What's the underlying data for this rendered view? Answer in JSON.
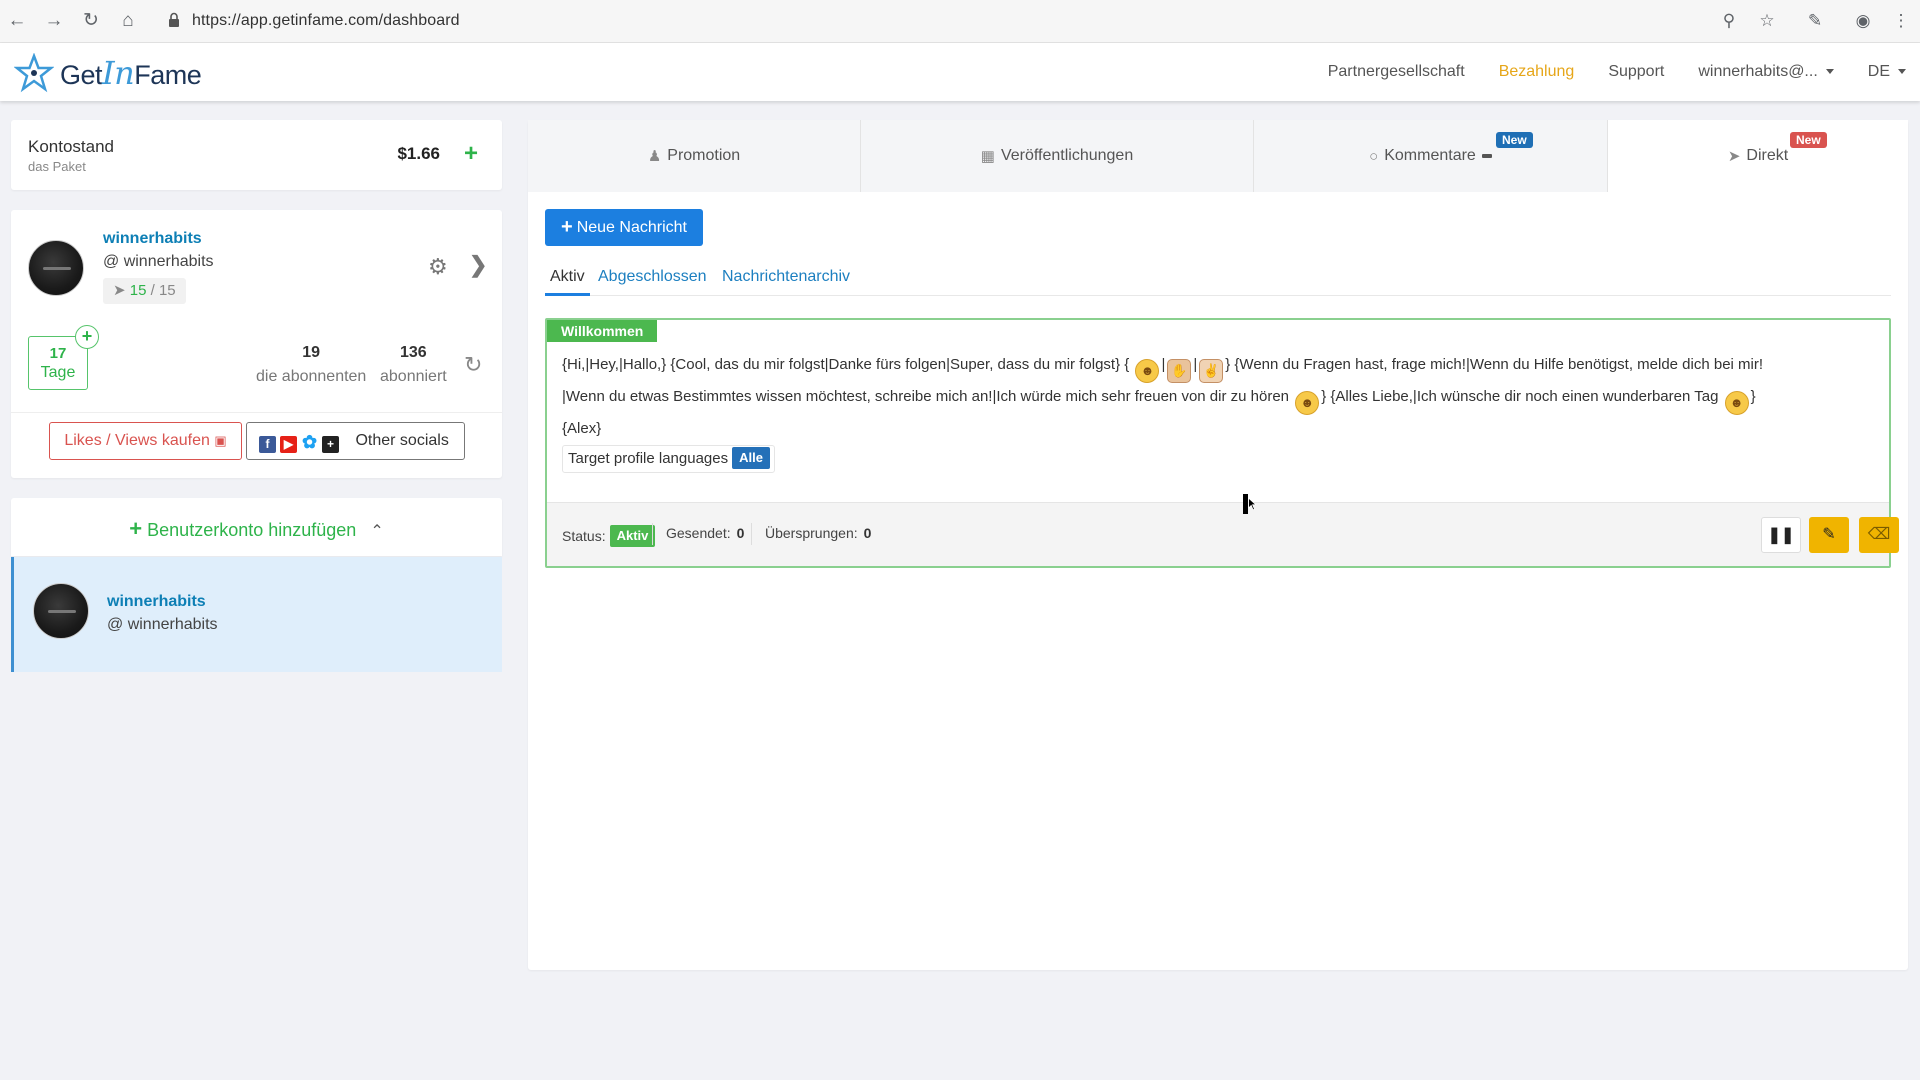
{
  "browser": {
    "url": "https://app.getinfame.com/dashboard",
    "icons": [
      "back-icon",
      "forward-icon",
      "reload-icon",
      "home-icon",
      "lock-icon",
      "key-icon",
      "star-icon",
      "extension-icon",
      "profile-icon",
      "menu-icon"
    ]
  },
  "header": {
    "logo_text_1": "Get",
    "logo_text_2": "In",
    "logo_text_3": "Fame",
    "nav": [
      {
        "label": "Partnergesellschaft"
      },
      {
        "label": "Bezahlung",
        "active": true
      },
      {
        "label": "Support"
      },
      {
        "label": "winnerhabits@..."
      },
      {
        "label": "DE"
      }
    ]
  },
  "balance": {
    "title": "Kontostand",
    "subtitle": "das Paket",
    "amount": "$1.66"
  },
  "profile": {
    "username": "winnerhabits",
    "handle": "@ winnerhabits",
    "quota_used": "15",
    "quota_sep": " / ",
    "quota_total": "15",
    "days_value": "17",
    "days_label": "Tage",
    "subscribers_value": "19",
    "subscribers_label": "die abonnenten",
    "subscribed_value": "136",
    "subscribed_label": "abonniert",
    "likes_button": "Likes / Views kaufen",
    "socials_button": "Other socials"
  },
  "accounts": {
    "add_label": "Benutzerkonto hinzufügen",
    "items": [
      {
        "username": "winnerhabits",
        "handle": "@ winnerhabits"
      }
    ]
  },
  "tabs": [
    {
      "label": "Promotion",
      "icon": "users-icon"
    },
    {
      "label": "Veröffentlichungen",
      "icon": "grid-icon"
    },
    {
      "label": "Kommentare",
      "icon": "comment-icon",
      "badge": "New"
    },
    {
      "label": "Direkt",
      "icon": "send-icon",
      "badge": "New",
      "active": true
    }
  ],
  "main": {
    "new_message_button": "Neue Nachricht",
    "subtabs": [
      {
        "label": "Aktiv",
        "active": true
      },
      {
        "label": "Abgeschlossen"
      },
      {
        "label": "Nachrichtenarchiv"
      }
    ]
  },
  "message": {
    "title": "Willkommen",
    "text_1": "{Hi,|Hey,|Hallo,} {Cool, das du mir folgst|Danke fürs folgen|Super, dass du mir folgst} {",
    "text_2": "} {Wenn du Fragen hast, frage mich!|Wenn du Hilfe benötigst, melde dich bei mir!",
    "text_3": "|Wenn du etwas Bestimmtes wissen möchtest, schreibe mich an!|Ich würde mich sehr freuen von dir zu hören",
    "text_4": "} {Alles Liebe,|Ich wünsche dir noch einen wunderbaren Tag",
    "text_5": "}",
    "text_6": "{Alex}",
    "langs_label": "Target profile languages",
    "langs_value": "Alle",
    "status_label": "Status:",
    "status_value": "Aktiv",
    "sent_label": "Gesendet:",
    "sent_value": "0",
    "skipped_label": "Übersprungen:",
    "skipped_value": "0"
  },
  "colors": {
    "accent": "#1c7fe0",
    "green": "#4cb84f",
    "active_nav": "#e6a619",
    "danger": "#d9534f",
    "warning": "#f0b400"
  }
}
